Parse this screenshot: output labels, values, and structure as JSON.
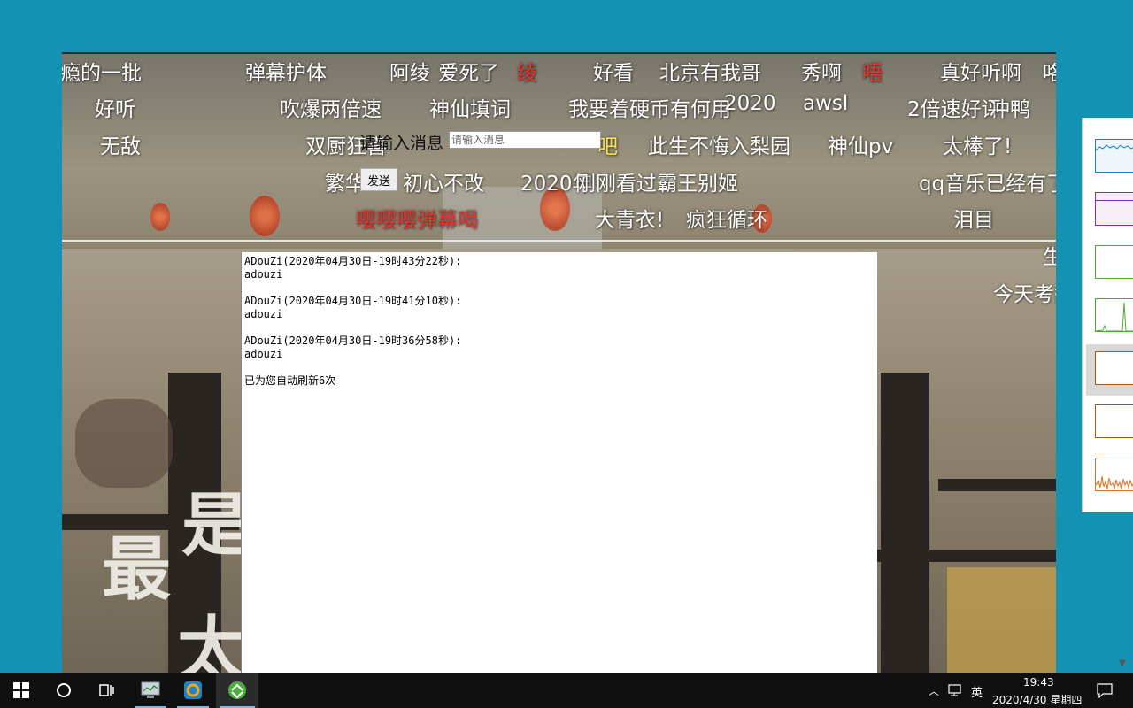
{
  "danmaku": [
    {
      "text": "瘾的一批",
      "color": "white"
    },
    {
      "text": "弹幕护体",
      "color": "white"
    },
    {
      "text": "阿绫",
      "color": "white"
    },
    {
      "text": "爱死了",
      "color": "white"
    },
    {
      "text": "绫",
      "color": "red"
    },
    {
      "text": "好看",
      "color": "white"
    },
    {
      "text": "北京有我哥",
      "color": "white"
    },
    {
      "text": "秀啊",
      "color": "white"
    },
    {
      "text": "唔",
      "color": "red"
    },
    {
      "text": "真好听啊",
      "color": "white"
    },
    {
      "text": "咯",
      "color": "white"
    },
    {
      "text": "好听",
      "color": "white"
    },
    {
      "text": "吹爆两倍速",
      "color": "white"
    },
    {
      "text": "神仙填词",
      "color": "white"
    },
    {
      "text": "我要着硬币有何用",
      "color": "white"
    },
    {
      "text": "2020",
      "color": "white"
    },
    {
      "text": "awsl",
      "color": "white"
    },
    {
      "text": "2倍速好评",
      "color": "white"
    },
    {
      "text": "冲鸭",
      "color": "white"
    },
    {
      "text": "无敌",
      "color": "white"
    },
    {
      "text": "双厨狂喜",
      "color": "white"
    },
    {
      "text": "吧",
      "color": "yellow"
    },
    {
      "text": "此生不悔入梨园",
      "color": "white"
    },
    {
      "text": "神仙pv",
      "color": "white"
    },
    {
      "text": "太棒了!",
      "color": "white"
    },
    {
      "text": "繁华",
      "color": "white"
    },
    {
      "text": "初心不改",
      "color": "white"
    },
    {
      "text": "2020年",
      "color": "white"
    },
    {
      "text": "刚刚看过霸王别姬",
      "color": "white"
    },
    {
      "text": "qq音乐已经有了",
      "color": "white"
    },
    {
      "text": "嘤嘤嘤弹幕喝",
      "color": "red"
    },
    {
      "text": "大青衣!",
      "color": "white"
    },
    {
      "text": "疯狂循环",
      "color": "white"
    },
    {
      "text": "泪目",
      "color": "white"
    },
    {
      "text": "生",
      "color": "white"
    },
    {
      "text": "今天考翻",
      "color": "white"
    }
  ],
  "input": {
    "label": "请输入消息",
    "placeholder": "请输入消息",
    "value": ""
  },
  "send_button": "发送",
  "messages": [
    {
      "header": "ADouZi(2020年04月30日-19时43分22秒):",
      "body": "adouzi"
    },
    {
      "header": "ADouZi(2020年04月30日-19时41分10秒):",
      "body": "adouzi"
    },
    {
      "header": "ADouZi(2020年04月30日-19时36分58秒):",
      "body": "adouzi"
    }
  ],
  "refresh_status": "已为您自动刷新6次",
  "background_chars": [
    "最",
    "是",
    "太"
  ],
  "side_panel_graphs": [
    {
      "color": "#1a7fc1"
    },
    {
      "color": "#8b2bb9"
    },
    {
      "color": "#4caa2f"
    },
    {
      "color": "#4caa2f"
    },
    {
      "color": "#a45a12"
    },
    {
      "color": "#a45a12"
    },
    {
      "color": "#d8752a"
    }
  ],
  "taskbar": {
    "items": [
      {
        "name": "start-icon"
      },
      {
        "name": "search-icon"
      },
      {
        "name": "task-view-icon"
      },
      {
        "name": "app-monitor-icon"
      },
      {
        "name": "app-browser-icon"
      },
      {
        "name": "app-green-icon"
      }
    ],
    "ime": "英",
    "time": "19:43",
    "date": "2020/4/30 星期四"
  }
}
